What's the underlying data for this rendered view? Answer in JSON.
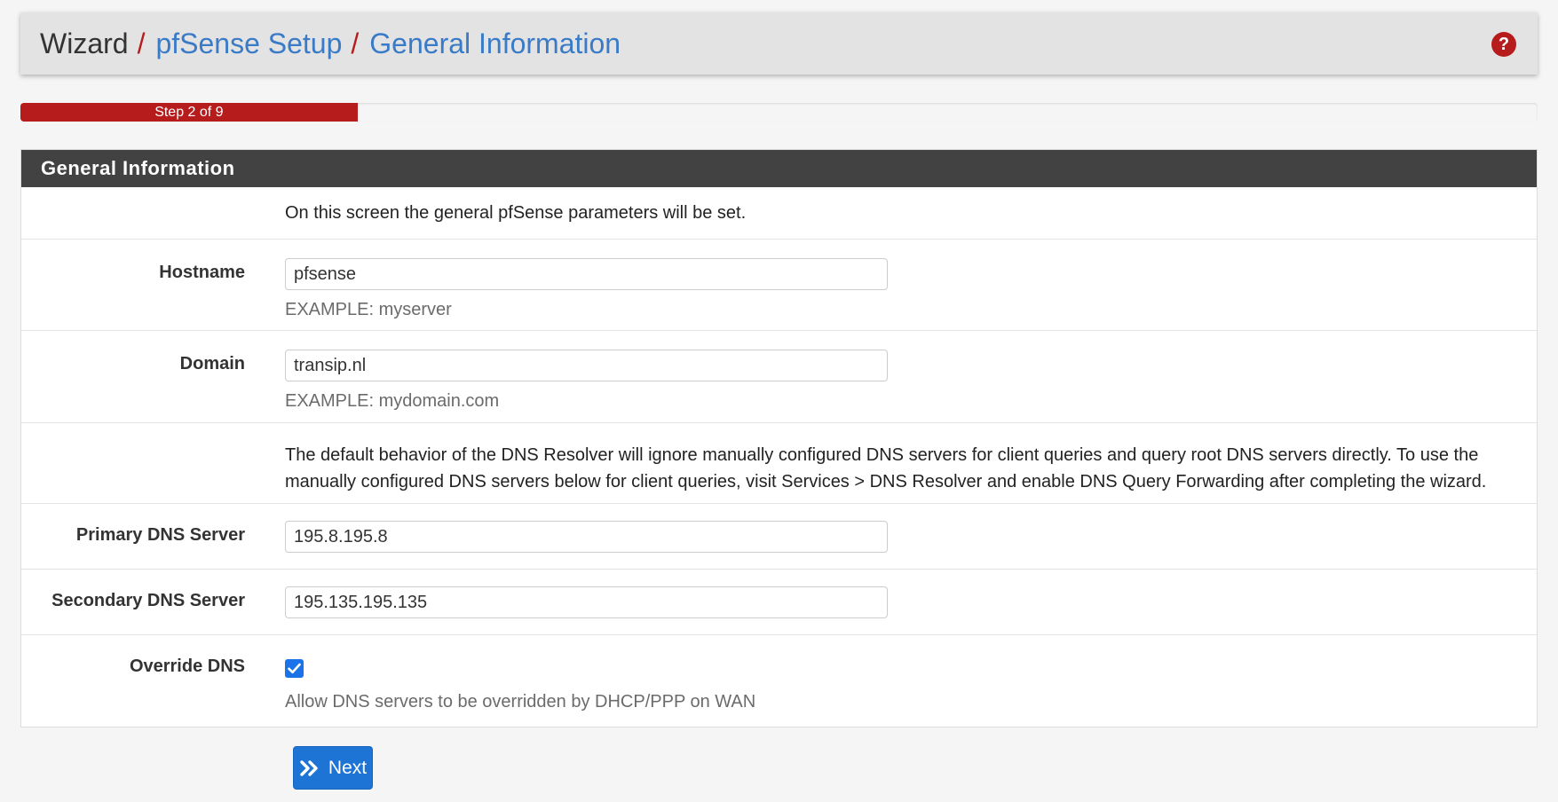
{
  "breadcrumb": {
    "root": "Wizard",
    "separator": "/",
    "items": [
      "pfSense Setup",
      "General Information"
    ]
  },
  "help_icon": "question-circle-icon",
  "progress": {
    "label": "Step 2 of 9",
    "current_step": 2,
    "total_steps": 9
  },
  "panel": {
    "title": "General Information",
    "intro": "On this screen the general pfSense parameters will be set.",
    "hostname": {
      "label": "Hostname",
      "value": "pfsense",
      "help": "EXAMPLE: myserver"
    },
    "domain": {
      "label": "Domain",
      "value": "transip.nl",
      "help": "EXAMPLE: mydomain.com"
    },
    "dns_notice_line1": "The default behavior of the DNS Resolver will ignore manually configured DNS servers for client queries and query root DNS servers directly. To use the",
    "dns_notice_line2": "manually configured DNS servers below for client queries, visit Services > DNS Resolver and enable DNS Query Forwarding after completing the wizard.",
    "primary_dns": {
      "label": "Primary DNS Server",
      "value": "195.8.195.8"
    },
    "secondary_dns": {
      "label": "Secondary DNS Server",
      "value": "195.135.195.135"
    },
    "override_dns": {
      "label": "Override DNS",
      "checked": true,
      "help": "Allow DNS servers to be overridden by DHCP/PPP on WAN"
    }
  },
  "next_button": {
    "label": "Next",
    "icon": "double-chevron-right-icon"
  },
  "colors": {
    "accent_red": "#b71c1c",
    "link_blue": "#3a7bc8",
    "button_blue": "#1e74d4",
    "panel_heading": "#424242"
  }
}
